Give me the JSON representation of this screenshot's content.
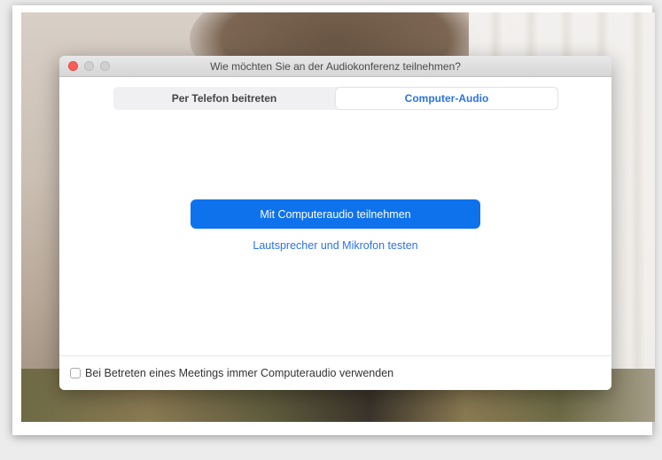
{
  "window": {
    "title": "Wie möchten Sie an der Audiokonferenz teilnehmen?"
  },
  "tabs": [
    {
      "label": "Per Telefon beitreten",
      "active": false
    },
    {
      "label": "Computer-Audio",
      "active": true
    }
  ],
  "main": {
    "join_label": "Mit Computeraudio teilnehmen",
    "test_label": "Lautsprecher und Mikrofon testen"
  },
  "footer": {
    "checkbox_label": "Bei Betreten eines Meetings immer Computeraudio verwenden",
    "checked": false
  },
  "colors": {
    "accent": "#0e72ed",
    "link": "#2a73e6",
    "close": "#fc5e57"
  }
}
